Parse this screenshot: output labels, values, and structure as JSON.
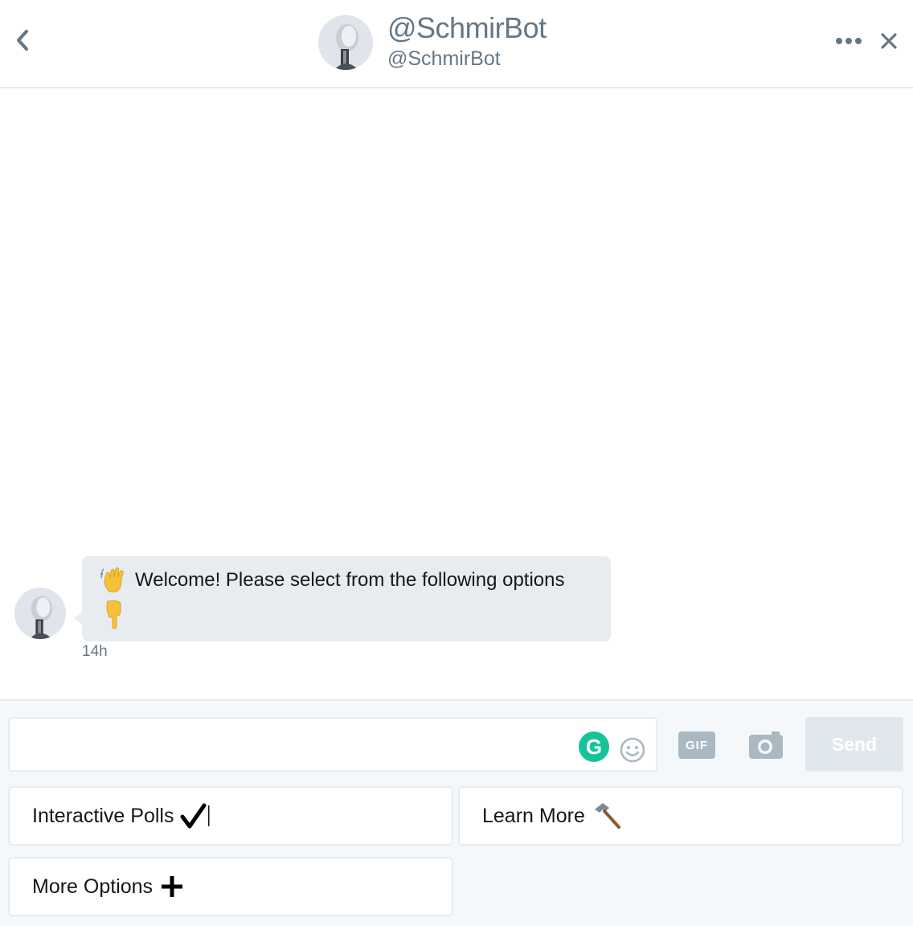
{
  "header": {
    "display_name": "@SchmirBot",
    "handle": "@SchmirBot"
  },
  "conversation": {
    "message_text": "Welcome! Please select from the following options",
    "timestamp": "14h"
  },
  "compose": {
    "placeholder": "",
    "grammarly_letter": "G",
    "gif_label": "GIF",
    "send_label": "Send"
  },
  "quick_replies": [
    {
      "label": "Interactive Polls",
      "icon": "check-mark-icon"
    },
    {
      "label": "Learn More",
      "icon": "hammer-icon"
    },
    {
      "label": "More Options",
      "icon": "plus-icon"
    }
  ],
  "colors": {
    "secondary_text": "#657786",
    "bubble_bg": "#e6ecf0",
    "footer_bg": "#f5f8fa",
    "send_disabled": "#e1e8ed",
    "grammarly": "#15c39a"
  }
}
